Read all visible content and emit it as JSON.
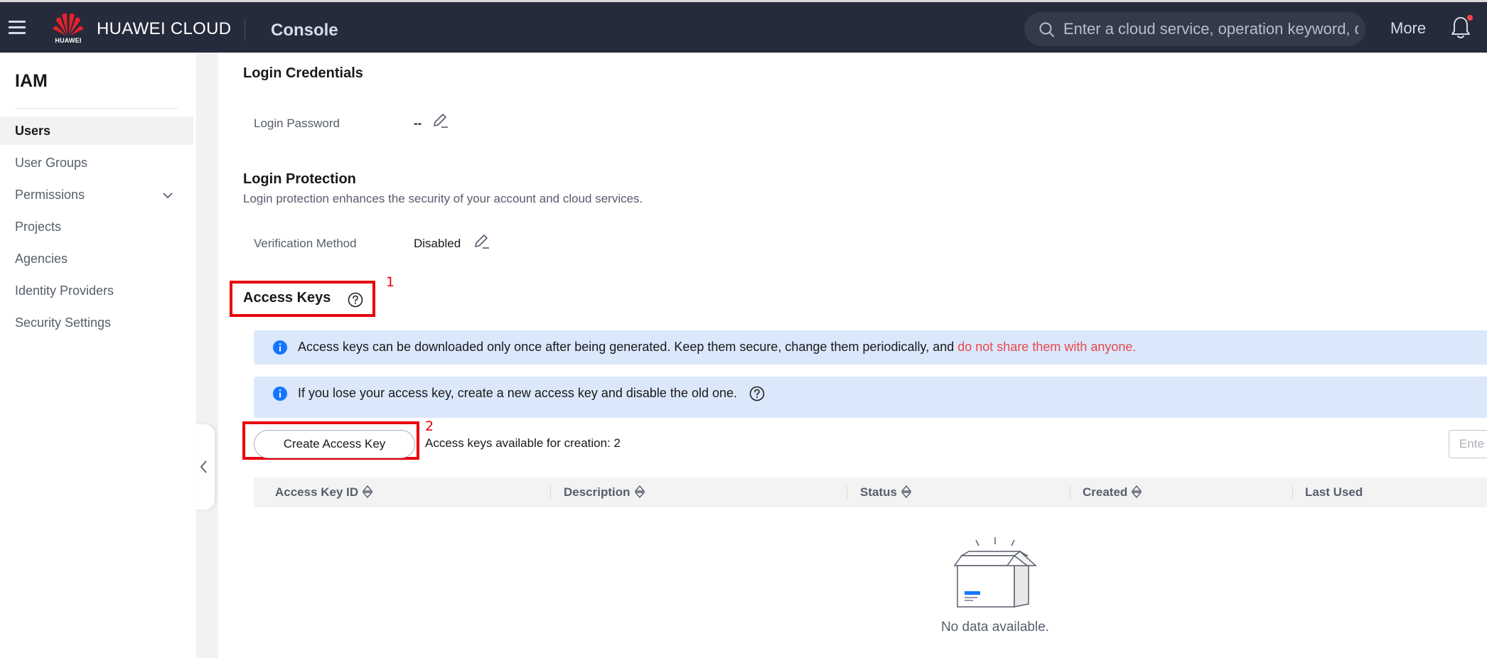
{
  "header": {
    "brand": "HUAWEI CLOUD",
    "logo_text": "HUAWEI",
    "console_label": "Console",
    "search_placeholder": "Enter a cloud service, operation keyword, d",
    "more_label": "More"
  },
  "sidebar": {
    "title": "IAM",
    "items": [
      {
        "label": "Users",
        "active": true
      },
      {
        "label": "User Groups"
      },
      {
        "label": "Permissions",
        "expandable": true
      },
      {
        "label": "Projects"
      },
      {
        "label": "Agencies"
      },
      {
        "label": "Identity Providers"
      },
      {
        "label": "Security Settings"
      }
    ]
  },
  "login_credentials": {
    "heading": "Login Credentials",
    "password_label": "Login Password",
    "password_value": "--"
  },
  "login_protection": {
    "heading": "Login Protection",
    "description": "Login protection enhances the security of your account and cloud services.",
    "method_label": "Verification Method",
    "method_value": "Disabled"
  },
  "access_keys": {
    "heading": "Access Keys",
    "annotation_1": "1",
    "annotation_2": "2",
    "notice_1_prefix": "Access keys can be downloaded only once after being generated. Keep them secure, change them periodically, and ",
    "notice_1_warning": "do not share them with anyone.",
    "notice_2": "If you lose your access key, create a new access key and disable the old one.",
    "create_button": "Create Access Key",
    "available_text": "Access keys available for creation: 2",
    "filter_placeholder": "Ente",
    "columns": [
      "Access Key ID",
      "Description",
      "Status",
      "Created",
      "Last Used"
    ],
    "empty_text": "No data available."
  },
  "colors": {
    "topbar_bg": "#252b3a",
    "info_bg": "#dbe8fc",
    "info_icon": "#1476ff",
    "annotation_red": "#e8000b",
    "danger_text": "#e8464c"
  }
}
